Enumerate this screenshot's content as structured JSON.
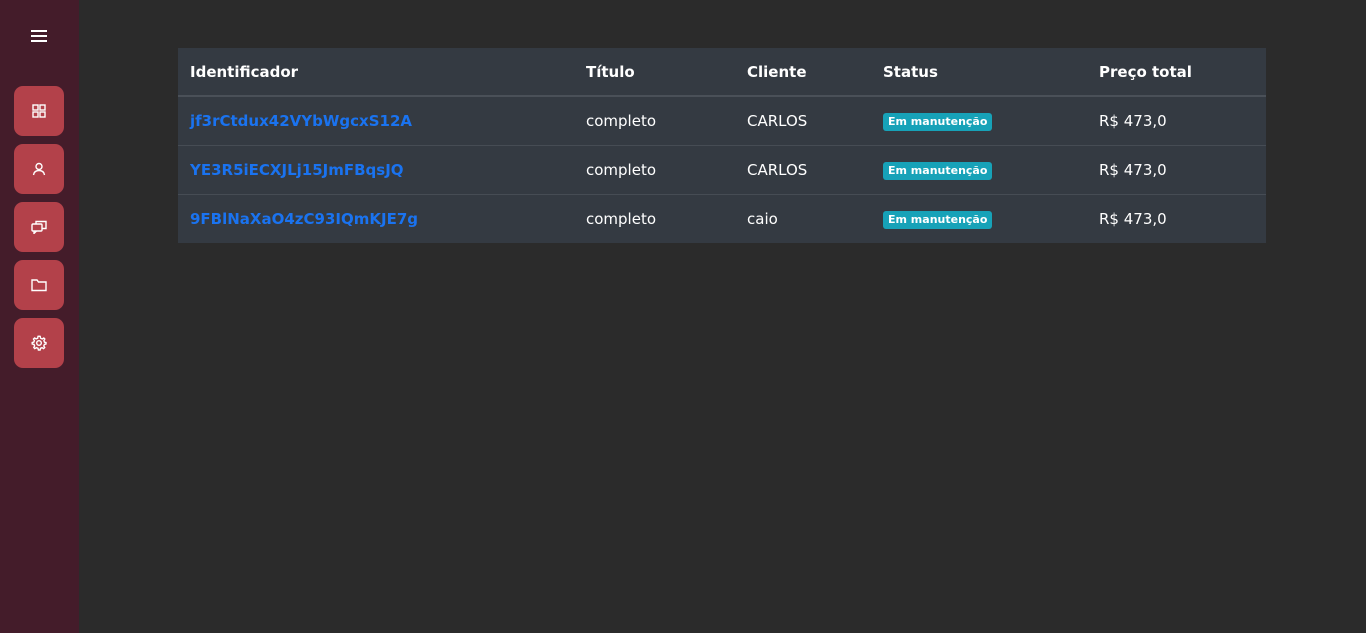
{
  "sidebar": {
    "menu_icon": "hamburger-icon",
    "items": [
      {
        "name": "dashboard",
        "icon": "grid-icon"
      },
      {
        "name": "users",
        "icon": "user-icon"
      },
      {
        "name": "messages",
        "icon": "chat-icon"
      },
      {
        "name": "folders",
        "icon": "folder-icon"
      },
      {
        "name": "settings",
        "icon": "gear-icon"
      }
    ],
    "colors": {
      "background": "#441c2a",
      "button": "#b3414a"
    }
  },
  "table": {
    "headers": {
      "id": "Identificador",
      "title": "Título",
      "client": "Cliente",
      "status": "Status",
      "price": "Preço total"
    },
    "rows": [
      {
        "id": "jf3rCtdux42VYbWgcxS12A",
        "title": "completo",
        "client": "CARLOS",
        "status": "Em manutenção",
        "price": "R$ 473,0"
      },
      {
        "id": "YE3R5iECXJLj15JmFBqsJQ",
        "title": "completo",
        "client": "CARLOS",
        "status": "Em manutenção",
        "price": "R$ 473,0"
      },
      {
        "id": "9FBlNaXaO4zC93IQmKJE7g",
        "title": "completo",
        "client": "caio",
        "status": "Em manutenção",
        "price": "R$ 473,0"
      }
    ]
  },
  "colors": {
    "page_background": "#2b2b2b",
    "table_background": "#343a42",
    "link": "#1a73f0",
    "badge": "#17a2b8"
  }
}
